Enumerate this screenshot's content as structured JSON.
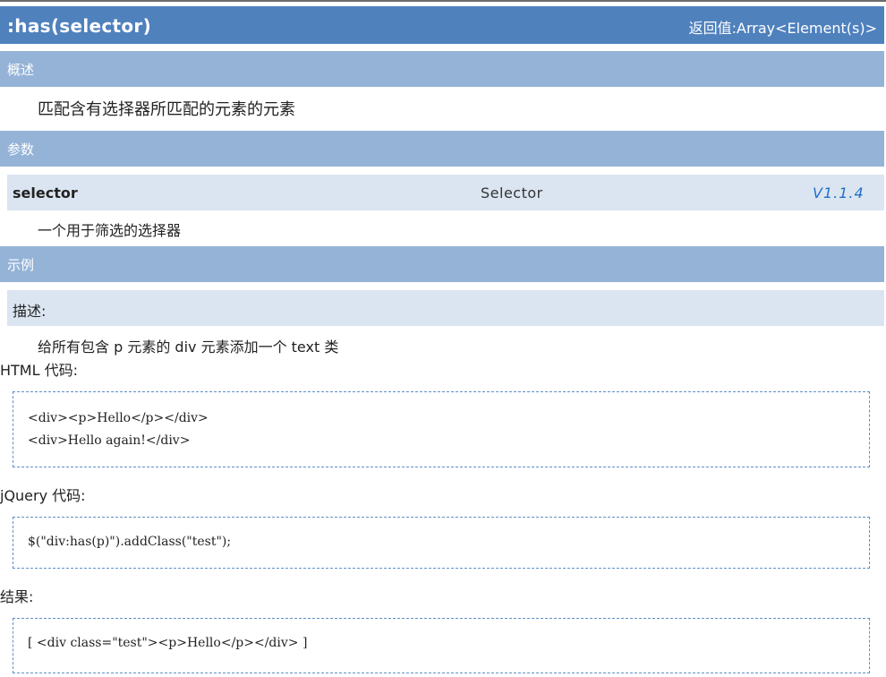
{
  "header": {
    "title": ":has(selector)",
    "return_value": "返回值:Array<Element(s)>"
  },
  "sections": {
    "overview": "概述",
    "params": "参数",
    "example": "示例"
  },
  "overview": {
    "description": "匹配含有选择器所匹配的元素的元素"
  },
  "param": {
    "name": "selector",
    "type": "Selector",
    "version": "V1.1.4",
    "description": "一个用于筛选的选择器"
  },
  "example": {
    "desc_label": "描述:",
    "desc_text": "给所有包含 p 元素的 div 元素添加一个 text 类",
    "html_label": "HTML 代码:",
    "html_code": [
      "<div><p>Hello</p></div>",
      "<div>Hello again!</div>"
    ],
    "jquery_label": "jQuery 代码:",
    "jquery_code": "$(\"div:has(p)\").addClass(\"test\");",
    "result_label": "结果:",
    "result_code": "[ <div class=\"test\"><p>Hello</p></div> ]"
  }
}
